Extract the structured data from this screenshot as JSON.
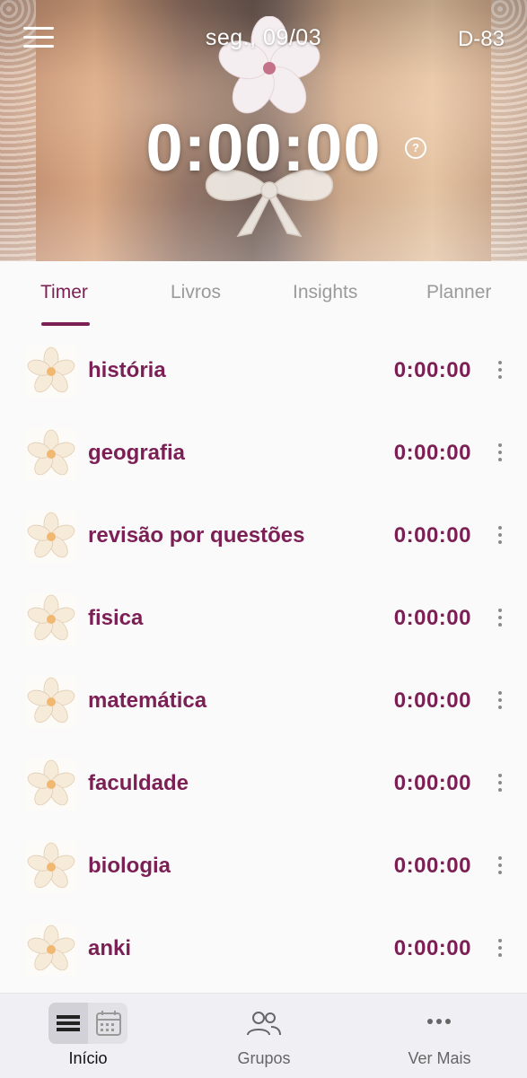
{
  "header": {
    "date": "seg., 09/03",
    "dday": "D-83",
    "timer": "0:00:00",
    "help_glyph": "?",
    "icons": {
      "menu": "menu-icon",
      "help": "help-circle-icon"
    }
  },
  "tabs": [
    {
      "label": "Timer",
      "active": true
    },
    {
      "label": "Livros",
      "active": false
    },
    {
      "label": "Insights",
      "active": false
    },
    {
      "label": "Planner",
      "active": false
    }
  ],
  "subjects": [
    {
      "name": "história",
      "time": "0:00:00"
    },
    {
      "name": "geografia",
      "time": "0:00:00"
    },
    {
      "name": "revisão por questões",
      "time": "0:00:00"
    },
    {
      "name": "fisica",
      "time": "0:00:00"
    },
    {
      "name": "matemática",
      "time": "0:00:00"
    },
    {
      "name": "faculdade",
      "time": "0:00:00"
    },
    {
      "name": "biologia",
      "time": "0:00:00"
    },
    {
      "name": "anki",
      "time": "0:00:00"
    }
  ],
  "bottom_nav": [
    {
      "label": "Início",
      "icon": "list-calendar-toggle-icon",
      "active": true
    },
    {
      "label": "Grupos",
      "icon": "people-icon",
      "active": false
    },
    {
      "label": "Ver Mais",
      "icon": "more-horizontal-icon",
      "active": false
    }
  ],
  "colors": {
    "accent": "#7b1f55",
    "inactive": "#9a9a9a",
    "background": "#fafafa",
    "nav_bg": "#f0eff3"
  }
}
